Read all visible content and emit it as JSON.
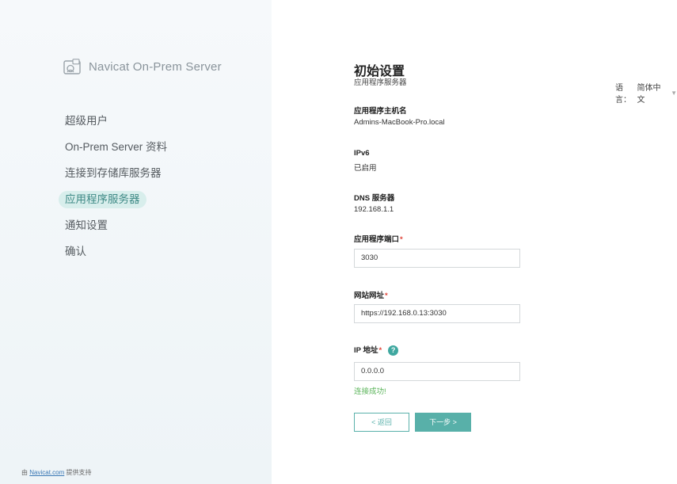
{
  "app": {
    "logo_text": "Navicat On-Prem Server"
  },
  "sidebar": {
    "items": [
      {
        "label": "超级用户",
        "active": false
      },
      {
        "label": "On-Prem Server 资料",
        "active": false
      },
      {
        "label": "连接到存储库服务器",
        "active": false
      },
      {
        "label": "应用程序服务器",
        "active": true
      },
      {
        "label": "通知设置",
        "active": false
      },
      {
        "label": "确认",
        "active": false
      }
    ],
    "footer_prefix": "由",
    "footer_link": "Navicat.com",
    "footer_suffix": "提供支持"
  },
  "language": {
    "label": "语言：",
    "value": "简体中文"
  },
  "page": {
    "title": "初始设置",
    "subtitle": "应用程序服务器"
  },
  "fields": {
    "hostname_label": "应用程序主机名",
    "hostname_value": "Admins-MacBook-Pro.local",
    "ipv6_label": "IPv6",
    "ipv6_value": "已启用",
    "dns_label": "DNS 服务器",
    "dns_value": "192.168.1.1",
    "port_label": "应用程序端口",
    "port_value": "3030",
    "url_label": "网站网址",
    "url_value": "https://192.168.0.13:3030",
    "ip_label": "IP 地址",
    "ip_value": "0.0.0.0",
    "required_mark": "*",
    "help_mark": "?",
    "status": "连接成功!"
  },
  "buttons": {
    "back": "< 返回",
    "next": "下一步 >"
  },
  "colors": {
    "accent": "#58b0a9",
    "success": "#5bb45a",
    "required": "#e0463b",
    "sidebar_active_bg": "#d8eeec"
  }
}
